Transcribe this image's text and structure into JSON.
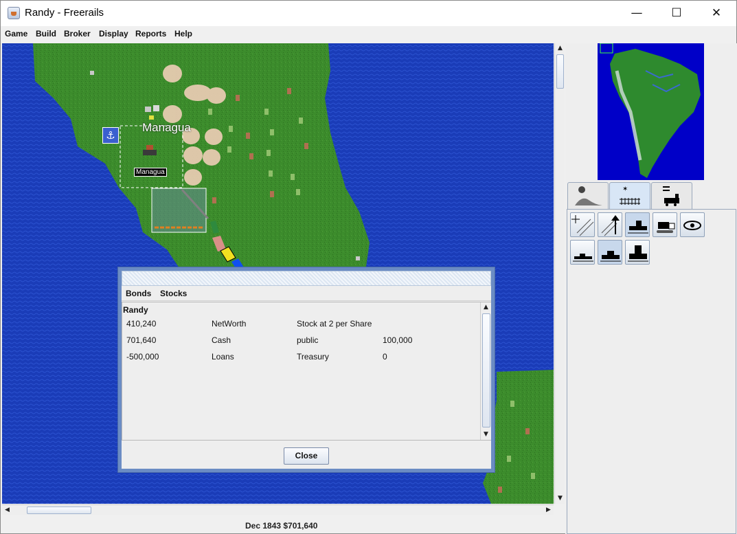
{
  "window": {
    "title": "Randy - Freerails",
    "minimize_glyph": "—",
    "maximize_glyph": "☐",
    "close_glyph": "✕"
  },
  "menubar": {
    "items": [
      {
        "label": "Game"
      },
      {
        "label": "Build"
      },
      {
        "label": "Broker"
      },
      {
        "label": "Display"
      },
      {
        "label": "Reports"
      },
      {
        "label": "Help"
      }
    ]
  },
  "map": {
    "city_name": "Managua",
    "station_label": "Managua",
    "colors": {
      "ocean": "#1a3cb8",
      "land": "#3c8c2c",
      "sand": "#e6cbb0"
    }
  },
  "statusbar": {
    "date_cash": "Dec 1843 $701,640"
  },
  "right_panel": {
    "tabs": [
      {
        "icon": "terrain-info-icon"
      },
      {
        "icon": "build-track-icon"
      },
      {
        "icon": "train-list-icon"
      }
    ],
    "tools": [
      {
        "icon": "build-track-tool-icon"
      },
      {
        "icon": "upgrade-track-tool-icon"
      },
      {
        "icon": "build-station-tool-icon"
      },
      {
        "icon": "bulldoze-tool-icon"
      },
      {
        "icon": "info-eye-tool-icon"
      },
      {
        "icon": "small-station-tool-icon"
      },
      {
        "icon": "medium-station-tool-icon"
      },
      {
        "icon": "large-station-tool-icon"
      }
    ]
  },
  "dialog": {
    "tabs": [
      {
        "label": "Bonds"
      },
      {
        "label": "Stocks"
      }
    ],
    "owner": "Randy",
    "rows": [
      {
        "value": "410,240",
        "label": "NetWorth",
        "stock_label": "Stock at 2 per Share",
        "stock_value": ""
      },
      {
        "value": "701,640",
        "label": "Cash",
        "stock_label": "public",
        "stock_value": "100,000"
      },
      {
        "value": "-500,000",
        "label": "Loans",
        "stock_label": "Treasury",
        "stock_value": "0"
      }
    ],
    "close_label": "Close"
  }
}
